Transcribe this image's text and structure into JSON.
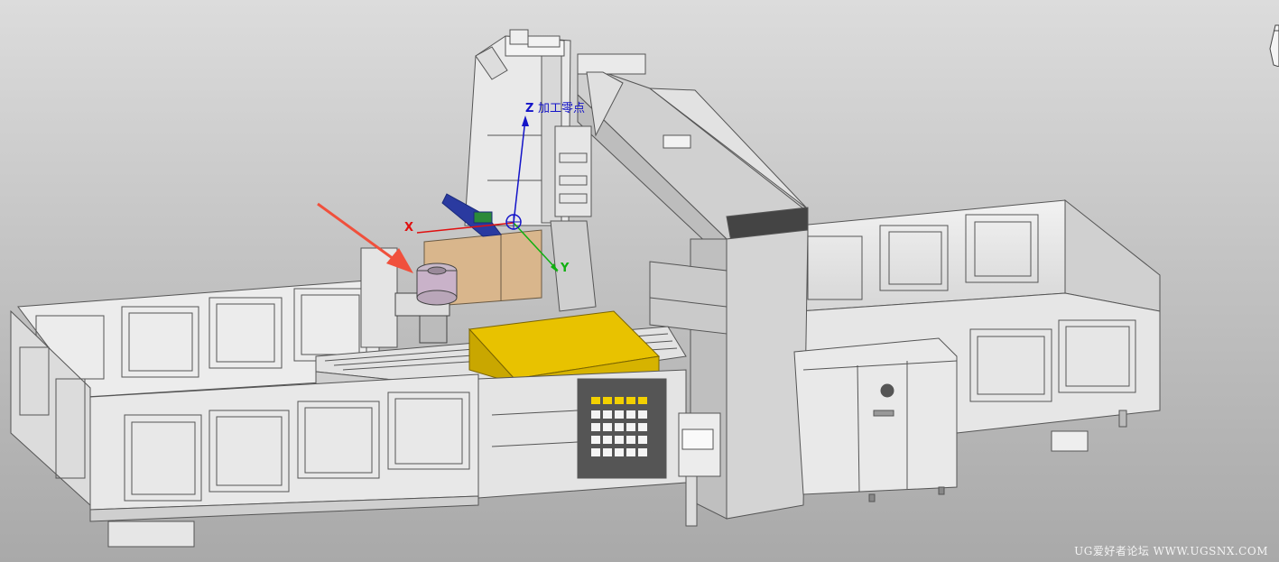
{
  "viewport": {
    "background_top": "#dcdcdc",
    "background_bottom": "#a9a9a9"
  },
  "wcs": {
    "x_label": "X",
    "y_label": "Y",
    "z_label": "Z",
    "origin_label": "加工零点",
    "x_color": "#e01010",
    "y_color": "#10b010",
    "z_color": "#1414c8"
  },
  "annotation": {
    "arrow_color": "#f0503c"
  },
  "highlights": {
    "workpiece_color": "#e8c200",
    "fixture_color": "#d9b68c"
  },
  "watermark": "UG爱好者论坛 WWW.UGSNX.COM"
}
